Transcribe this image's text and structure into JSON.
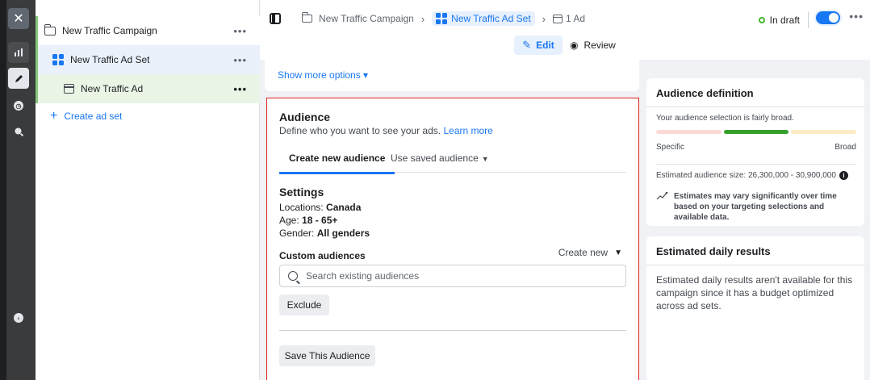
{
  "rail": {
    "icons": [
      "close-icon",
      "chart-icon",
      "pencil-icon",
      "clock-icon",
      "search-icon",
      "collapse-icon"
    ]
  },
  "tree": {
    "campaign": "New Traffic Campaign",
    "adset": "New Traffic Ad Set",
    "ad": "New Traffic Ad",
    "create_adset": "Create ad set",
    "more": "•••"
  },
  "topbar": {
    "crumbs": [
      "New Traffic Campaign",
      "New Traffic Ad Set",
      "1 Ad"
    ],
    "status": "In draft",
    "toggle_on": true,
    "edit_label": "Edit",
    "review_label": "Review"
  },
  "show_more": "Show more options ▾",
  "audience": {
    "title": "Audience",
    "subtitle": "Define who you want to see your ads.",
    "learn_more": "Learn more",
    "tab_new": "Create new audience",
    "tab_saved": "Use saved audience",
    "settings_title": "Settings",
    "locations_label": "Locations:",
    "locations_value": "Canada",
    "age_label": "Age:",
    "age_value": "18 - 65+",
    "gender_label": "Gender:",
    "gender_value": "All genders",
    "custom_label": "Custom audiences",
    "create_new": "Create new",
    "search_placeholder": "Search existing audiences",
    "exclude": "Exclude",
    "save_audience": "Save This Audience"
  },
  "definition": {
    "title": "Audience definition",
    "text": "Your audience selection is fairly broad.",
    "specific": "Specific",
    "broad": "Broad",
    "size": "Estimated audience size: 26,300,000 - 30,900,000",
    "note": "Estimates may vary significantly over time based on your targeting selections and available data."
  },
  "daily": {
    "title": "Estimated daily results",
    "text": "Estimated daily results aren't available for this campaign since it has a budget optimized across ad sets."
  },
  "colors": {
    "accent": "#1877f2",
    "highlight_border": "#e0211d",
    "meter_good": "#35a12b",
    "status_green": "#42b72a"
  }
}
